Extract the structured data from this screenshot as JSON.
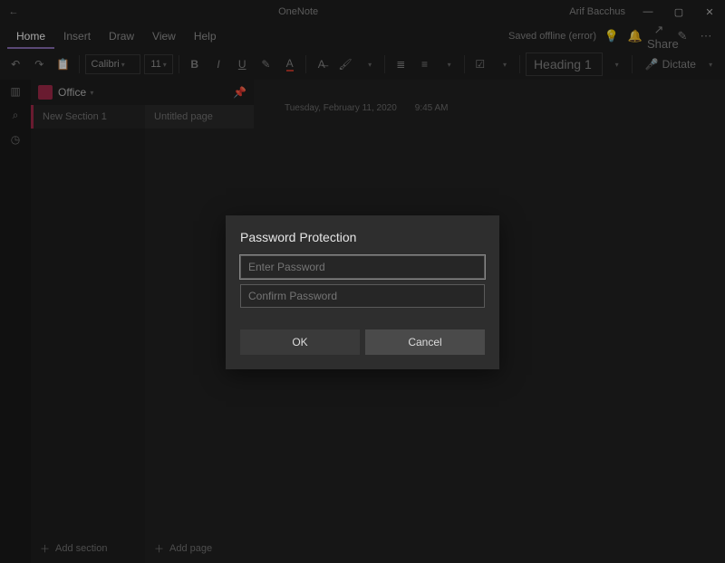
{
  "titlebar": {
    "app": "OneNote",
    "user": "Arif Bacchus"
  },
  "menu": {
    "items": [
      "Home",
      "Insert",
      "Draw",
      "View",
      "Help"
    ],
    "saved_offline": "Saved offline (error)",
    "share": "Share"
  },
  "ribbon": {
    "font_name": "Calibri",
    "font_size": "11",
    "style": "Heading 1",
    "dictate": "Dictate"
  },
  "notebook": {
    "name": "Office"
  },
  "section": {
    "name": "New Section 1"
  },
  "page": {
    "name": "Untitled page"
  },
  "canvas": {
    "date": "Tuesday, February 11, 2020",
    "time": "9:45 AM"
  },
  "footer": {
    "add_section": "Add section",
    "add_page": "Add page"
  },
  "dialog": {
    "title": "Password Protection",
    "enter_placeholder": "Enter Password",
    "confirm_placeholder": "Confirm Password",
    "ok": "OK",
    "cancel": "Cancel"
  }
}
